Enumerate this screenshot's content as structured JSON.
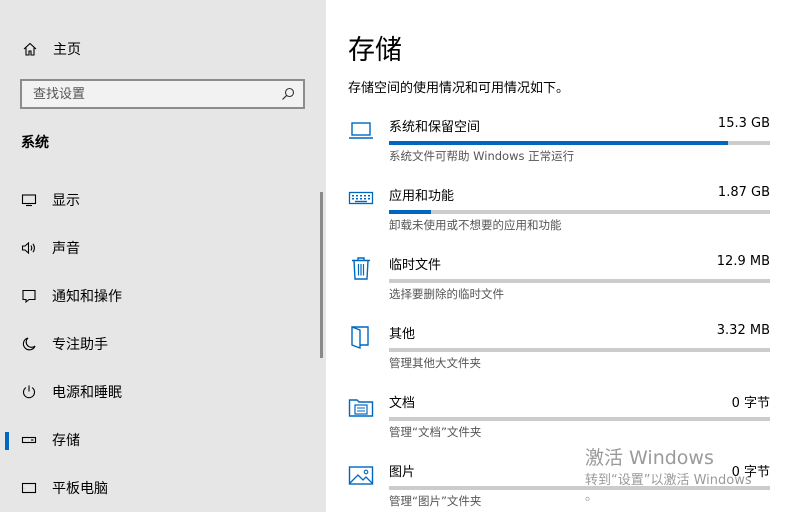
{
  "sidebar": {
    "home_label": "主页",
    "search": {
      "placeholder": "查找设置",
      "value": ""
    },
    "section_title": "系统",
    "items": [
      {
        "label": "显示",
        "icon": "display-icon"
      },
      {
        "label": "声音",
        "icon": "speaker-icon"
      },
      {
        "label": "通知和操作",
        "icon": "notification-icon"
      },
      {
        "label": "专注助手",
        "icon": "moon-icon"
      },
      {
        "label": "电源和睡眠",
        "icon": "power-icon"
      },
      {
        "label": "存储",
        "icon": "storage-drive-icon",
        "active": true
      },
      {
        "label": "平板电脑",
        "icon": "tablet-icon"
      }
    ]
  },
  "main": {
    "title": "存储",
    "description": "存储空间的使用情况和可用情况如下。",
    "items": [
      {
        "name": "系统和保留空间",
        "size": "15.3 GB",
        "desc": "系统文件可帮助 Windows 正常运行",
        "fill": 0.89,
        "icon": "laptop-icon"
      },
      {
        "name": "应用和功能",
        "size": "1.87 GB",
        "desc": "卸载未使用或不想要的应用和功能",
        "fill": 0.11,
        "icon": "keyboard-icon"
      },
      {
        "name": "临时文件",
        "size": "12.9 MB",
        "desc": "选择要删除的临时文件",
        "fill": 0.0,
        "icon": "trash-icon"
      },
      {
        "name": "其他",
        "size": "3.32 MB",
        "desc": "管理其他大文件夹",
        "fill": 0.0,
        "icon": "folder-open-icon"
      },
      {
        "name": "文档",
        "size": "0 字节",
        "desc": "管理“文档”文件夹",
        "fill": 0.0,
        "icon": "documents-folder-icon"
      },
      {
        "name": "图片",
        "size": "0 字节",
        "desc": "管理“图片”文件夹",
        "fill": 0.0,
        "icon": "pictures-icon"
      }
    ]
  },
  "watermark": {
    "title": "激活 Windows",
    "subtitle": "转到“设置”以激活 Windows",
    "trailing": "。"
  },
  "colors": {
    "accent": "#0067c0",
    "sidebar_bg": "#e6e6e6",
    "bar_bg": "#cccccc"
  }
}
